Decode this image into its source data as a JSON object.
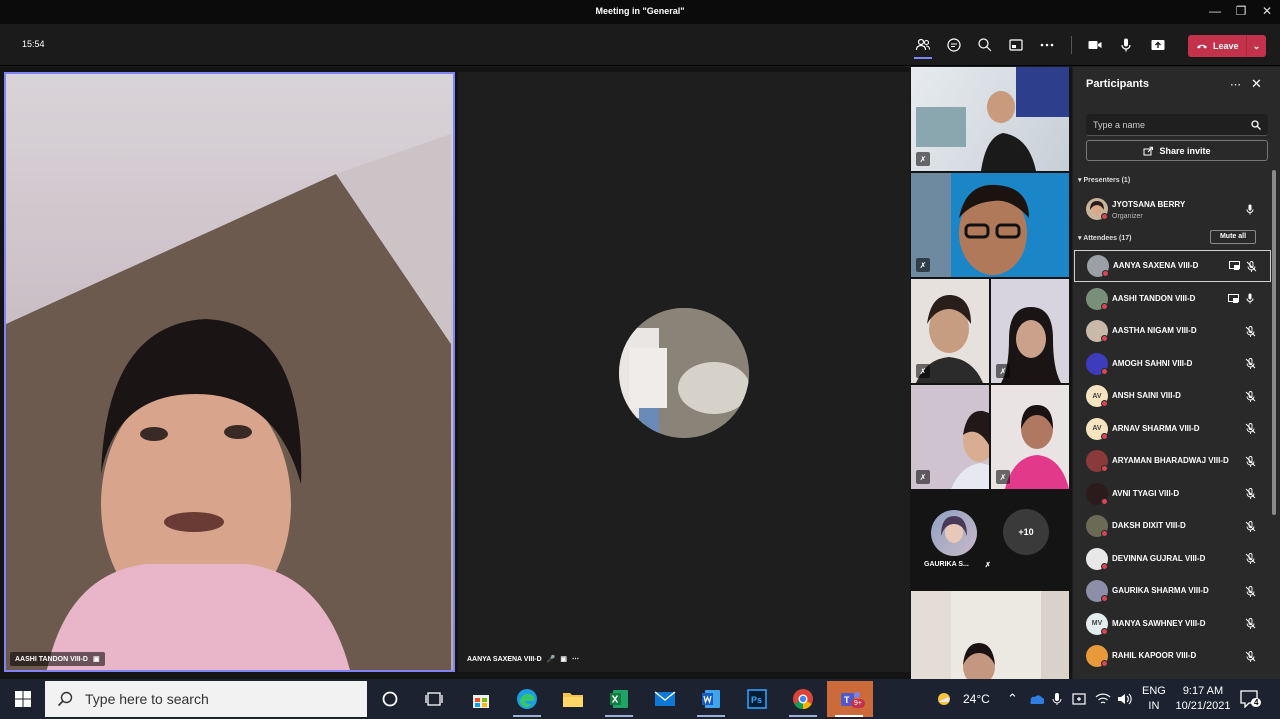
{
  "window": {
    "title": "Meeting in \"General\""
  },
  "toolbar": {
    "timer": "15:54",
    "leave_label": "Leave"
  },
  "stage": {
    "main_label": "AASHI TANDON VIII-D",
    "center_label": "AANYA SAXENA VIII-D",
    "overflow_label": "GAURIKA S...",
    "overflow_count": "+10"
  },
  "panel": {
    "title": "Participants",
    "search_placeholder": "Type a name",
    "share_label": "Share invite",
    "presenters_header": "Presenters (1)",
    "attendees_header": "Attendees (17)",
    "mute_all_label": "Mute all",
    "presenter": {
      "name": "JYOTSANA BERRY",
      "role": "Organizer"
    },
    "attendees": [
      {
        "name": "AANYA SAXENA VIII-D",
        "initials": "",
        "color": "#9aa0a6"
      },
      {
        "name": "AASHI TANDON VIII-D",
        "initials": "",
        "color": "#7a8f7a"
      },
      {
        "name": "AASTHA NIGAM VIII-D",
        "initials": "",
        "color": "#c9b9a8"
      },
      {
        "name": "AMOGH SAHNI VIII-D",
        "initials": "",
        "color": "#3c3cbd"
      },
      {
        "name": "ANSH SAINI VIII-D",
        "initials": "AV",
        "color": "#f6e4c0"
      },
      {
        "name": "ARNAV SHARMA VIII-D",
        "initials": "AV",
        "color": "#f6e4c0"
      },
      {
        "name": "ARYAMAN BHARADWAJ VIII-D",
        "initials": "",
        "color": "#8a3a3a"
      },
      {
        "name": "AVNI TYAGI VIII-D",
        "initials": "",
        "color": "#2b1b1b"
      },
      {
        "name": "DAKSH DIXIT VIII-D",
        "initials": "",
        "color": "#6b6b55"
      },
      {
        "name": "DEVINNA GUJRAL VIII-D",
        "initials": "",
        "color": "#e8e8e8"
      },
      {
        "name": "GAURIKA SHARMA VIII-D",
        "initials": "",
        "color": "#8d8fa8"
      },
      {
        "name": "MANYA SAWHNEY VIII-D",
        "initials": "MV",
        "color": "#e3edf0"
      },
      {
        "name": "RAHIL KAPOOR VIII-D",
        "initials": "",
        "color": "#e89a3a"
      }
    ]
  },
  "taskbar": {
    "search_placeholder": "Type here to search",
    "temperature": "24°C",
    "lang_top": "ENG",
    "lang_bottom": "IN",
    "time": "9:17 AM",
    "date": "10/21/2021",
    "notification_count": "4",
    "teams_badge": "9+"
  },
  "colors": {
    "accent": "#7f85f5",
    "leave": "#c4314b",
    "panel": "#292929",
    "taskbar": "#1c2230"
  }
}
